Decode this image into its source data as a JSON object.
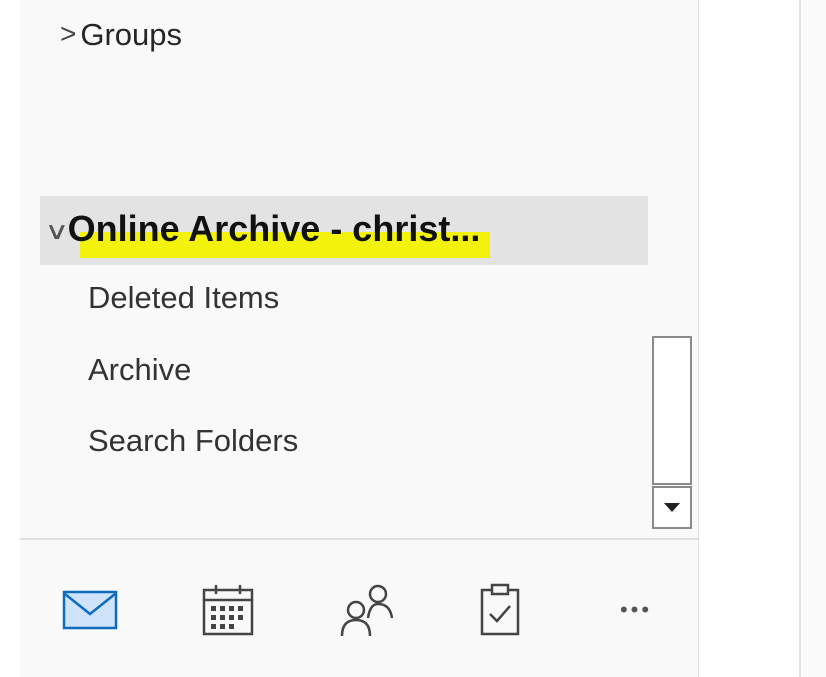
{
  "folders": {
    "groups": {
      "label": "Groups",
      "icon": "chevron-right-icon"
    },
    "archive": {
      "title": "Online Archive - christ...",
      "icon": "chevron-down-icon",
      "highlight_color": "#f2f200",
      "items": [
        {
          "label": "Deleted Items"
        },
        {
          "label": "Archive"
        },
        {
          "label": "Search Folders"
        }
      ]
    }
  },
  "nav": [
    {
      "name": "mail",
      "icon": "mail-icon",
      "accent": "#0f6cbd"
    },
    {
      "name": "calendar",
      "icon": "calendar-icon"
    },
    {
      "name": "people",
      "icon": "people-icon"
    },
    {
      "name": "tasks",
      "icon": "tasks-icon"
    },
    {
      "name": "more",
      "icon": "more-icon",
      "glyph": "•••"
    }
  ]
}
